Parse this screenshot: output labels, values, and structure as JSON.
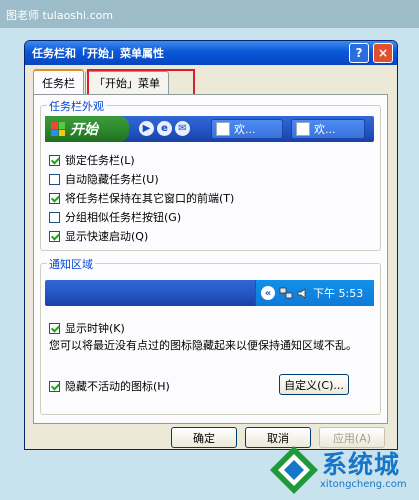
{
  "watermark": {
    "top_text": "图老师 tulaoshi.com",
    "bottom_text": "系统城",
    "bottom_url": "xitongcheng.com"
  },
  "window": {
    "title": "任务栏和「开始」菜单属性",
    "help_glyph": "?",
    "close_glyph": "×",
    "tabs": [
      {
        "label": "任务栏",
        "active": true
      },
      {
        "label": "「开始」菜单",
        "active": false
      }
    ]
  },
  "taskbar_appearance": {
    "group_title": "任务栏外观",
    "preview": {
      "start_label": "开始",
      "window_button_1": "欢...",
      "window_button_2": "欢..."
    },
    "options": [
      {
        "label": "锁定任务栏(L)",
        "checked": true
      },
      {
        "label": "自动隐藏任务栏(U)",
        "checked": false
      },
      {
        "label": "将任务栏保持在其它窗口的前端(T)",
        "checked": true
      },
      {
        "label": "分组相似任务栏按钮(G)",
        "checked": false
      },
      {
        "label": "显示快速启动(Q)",
        "checked": true
      }
    ]
  },
  "notification_area": {
    "group_title": "通知区域",
    "preview": {
      "expand_glyph": "«",
      "clock": "下午 5:53"
    },
    "show_clock": {
      "label": "显示时钟(K)",
      "checked": true
    },
    "description": "您可以将最近没有点过的图标隐藏起来以便保持通知区域不乱。",
    "hide_inactive": {
      "label": "隐藏不活动的图标(H)",
      "checked": true
    },
    "customize_button": "自定义(C)..."
  },
  "buttons": {
    "ok": "确定",
    "cancel": "取消",
    "apply": "应用(A)"
  },
  "colors": {
    "title_bar": "#0a58d8",
    "start_green": "#2d8a2d",
    "highlight_red": "#d8202a",
    "group_title": "#0046d5"
  }
}
